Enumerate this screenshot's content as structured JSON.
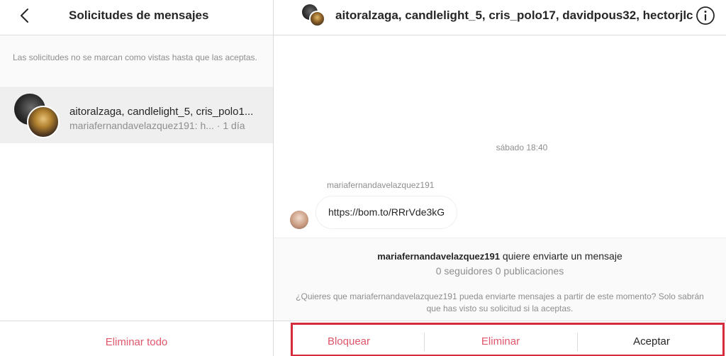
{
  "left_panel": {
    "title": "Solicitudes de mensajes",
    "back_icon": "chevron-left-icon",
    "info_note": "Las solicitudes no se marcan como vistas hasta que las aceptas.",
    "thread": {
      "name": "aitoralzaga, candlelight_5, cris_polo1...",
      "preview": "mariafernandavelazquez191: h...",
      "time": "· 1 día"
    },
    "delete_all": "Eliminar todo"
  },
  "conversation": {
    "title": "aitoralzaga, candlelight_5, cris_polo17, davidpous32, hectorjlc",
    "info_icon": "info-icon",
    "timestamp": "sábado 18:40",
    "message": {
      "sender": "mariafernandavelazquez191",
      "text": "https://bom.to/RRrVde3kG"
    },
    "request": {
      "username": "mariafernandavelazquez191",
      "suffix": "quiere enviarte un mensaje",
      "stats": "0 seguidores 0 publicaciones",
      "note": "¿Quieres que mariafernandavelazquez191 pueda enviarte mensajes a partir de este momento? Solo sabrán que has visto su solicitud si la aceptas."
    },
    "actions": {
      "block": "Bloquear",
      "delete": "Eliminar",
      "accept": "Aceptar"
    }
  },
  "colors": {
    "danger": "#e0566b",
    "highlight": "#d62b3a",
    "text": "#262626",
    "muted": "#8e8e8e",
    "border": "#dbdbdb"
  }
}
